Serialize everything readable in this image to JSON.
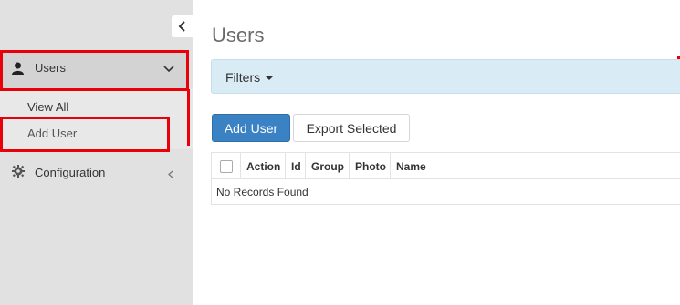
{
  "sidebar": {
    "users_label": "Users",
    "submenu": {
      "view_all": "View All",
      "add_user": "Add User"
    },
    "configuration_label": "Configuration"
  },
  "main": {
    "title": "Users",
    "filters_label": "Filters",
    "buttons": {
      "add_user": "Add User",
      "export_selected": "Export Selected"
    },
    "table": {
      "headers": [
        "Action",
        "Id",
        "Group",
        "Photo",
        "Name"
      ],
      "empty_text": "No Records Found"
    }
  },
  "colors": {
    "annotation_red": "#e8000b",
    "primary_button": "#3b82c4",
    "filters_bg": "#d9ecf6",
    "sidebar_bg": "#e1e1e1"
  },
  "icons": {
    "collapse": "chevron-left-icon",
    "users": "user-icon",
    "users_toggle": "chevron-down-icon",
    "configuration": "gear-icon",
    "configuration_toggle": "chevron-left-icon",
    "filters_toggle": "caret-down-icon"
  }
}
